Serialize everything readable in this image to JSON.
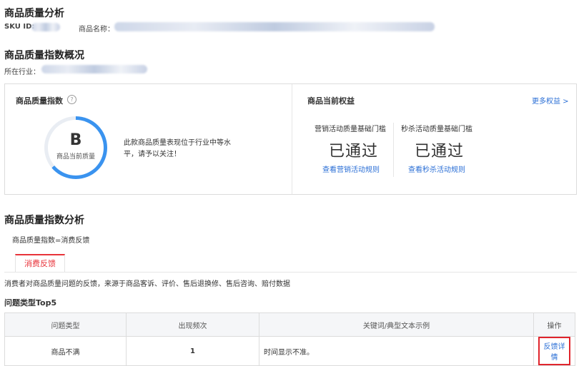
{
  "header": {
    "title": "商品质量分析",
    "sku_label": "SKU ID:",
    "name_label": "商品名称："
  },
  "overview": {
    "title": "商品质量指数概况",
    "industry_label": "所在行业："
  },
  "quality_card": {
    "title": "商品质量指数",
    "help_icon_glyph": "?",
    "grade": "B",
    "grade_sub": "商品当前质量",
    "ring_fill_fraction": 0.64,
    "desc_line1": "此款商品质量表现位于行业中等水",
    "desc_line2": "平，请予以关注！"
  },
  "benefits": {
    "title": "商品当前权益",
    "more_link": "更多权益 >",
    "items": [
      {
        "label": "营销活动质量基础门槛",
        "status": "已通过",
        "link": "查看营销活动规则"
      },
      {
        "label": "秒杀活动质量基础门槛",
        "status": "已通过",
        "link": "查看秒杀活动规则"
      }
    ]
  },
  "analysis": {
    "title": "商品质量指数分析",
    "formula": "商品质量指数=消费反馈",
    "tab_label": "消费反馈",
    "description": "消费者对商品质量问题的反馈，来源于商品客诉、评价、售后退换修、售后咨询、赔付数据",
    "top5_title": "问题类型Top5"
  },
  "table": {
    "headers": [
      "问题类型",
      "出现频次",
      "关键词/典型文本示例",
      "操作"
    ],
    "rows": [
      {
        "type": "商品不满",
        "count": "1",
        "example": "时间显示不准。",
        "action": "反馈详情"
      }
    ]
  },
  "colors": {
    "accent_blue": "#3a93ef",
    "link_blue": "#2b6fd6",
    "tab_red": "#e8333a"
  }
}
